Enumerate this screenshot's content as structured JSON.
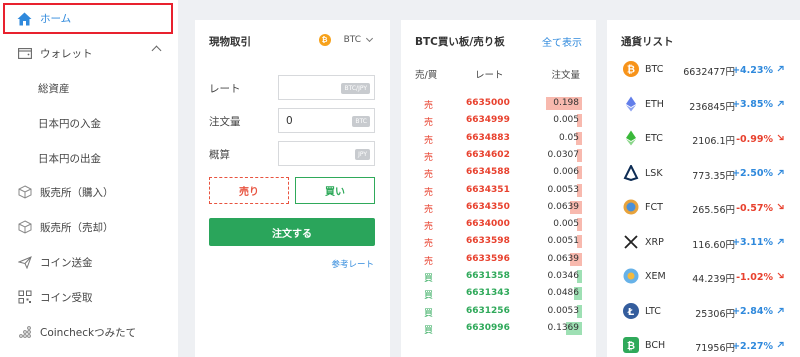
{
  "sidebar": {
    "items": [
      {
        "label": "ホーム",
        "icon": "home-icon",
        "active": true
      },
      {
        "label": "ウォレット",
        "icon": "wallet-icon"
      },
      {
        "label": "総資産"
      },
      {
        "label": "日本円の入金"
      },
      {
        "label": "日本円の出金"
      },
      {
        "label": "販売所（購入）",
        "icon": "cube-icon"
      },
      {
        "label": "販売所（売却）",
        "icon": "cube-icon"
      },
      {
        "label": "コイン送金",
        "icon": "send-icon"
      },
      {
        "label": "コイン受取",
        "icon": "qr-icon"
      },
      {
        "label": "Coincheckつみたて",
        "icon": "dots-icon"
      }
    ]
  },
  "trade": {
    "title": "現物取引",
    "coin": "BTC",
    "rate_label": "レート",
    "rate_value": "",
    "rate_unit": "BTC/JPY",
    "amount_label": "注文量",
    "amount_value": "0",
    "amount_unit": "BTC",
    "estimate_label": "概算",
    "estimate_value": "",
    "estimate_unit": "JPY",
    "sell_label": "売り",
    "buy_label": "買い",
    "order_label": "注文する",
    "ref_link": "参考レート"
  },
  "book": {
    "title": "BTC買い板/売り板",
    "link": "全て表示",
    "headers": {
      "side": "売/買",
      "rate": "レート",
      "amount": "注文量"
    },
    "rows": [
      {
        "side": "売",
        "type": "sell",
        "price": "6635000",
        "amount": "0.198",
        "depth": 0.45
      },
      {
        "side": "売",
        "type": "sell",
        "price": "6634999",
        "amount": "0.005",
        "depth": 0.0
      },
      {
        "side": "売",
        "type": "sell",
        "price": "6634883",
        "amount": "0.05",
        "depth": 0.08
      },
      {
        "side": "売",
        "type": "sell",
        "price": "6634602",
        "amount": "0.0307",
        "depth": 0.05
      },
      {
        "side": "売",
        "type": "sell",
        "price": "6634588",
        "amount": "0.006",
        "depth": 0.0
      },
      {
        "side": "売",
        "type": "sell",
        "price": "6634351",
        "amount": "0.0053",
        "depth": 0.05
      },
      {
        "side": "売",
        "type": "sell",
        "price": "6634350",
        "amount": "0.0639",
        "depth": 0.15
      },
      {
        "side": "売",
        "type": "sell",
        "price": "6634000",
        "amount": "0.005",
        "depth": 0.0
      },
      {
        "side": "売",
        "type": "sell",
        "price": "6633598",
        "amount": "0.0051",
        "depth": 0.05
      },
      {
        "side": "売",
        "type": "sell",
        "price": "6633596",
        "amount": "0.0639",
        "depth": 0.15
      },
      {
        "side": "買",
        "type": "buy",
        "price": "6631358",
        "amount": "0.0346",
        "depth": 0.05
      },
      {
        "side": "買",
        "type": "buy",
        "price": "6631343",
        "amount": "0.0486",
        "depth": 0.1
      },
      {
        "side": "買",
        "type": "buy",
        "price": "6631256",
        "amount": "0.0053",
        "depth": 0.05
      },
      {
        "side": "買",
        "type": "buy",
        "price": "6630996",
        "amount": "0.1369",
        "depth": 0.2
      }
    ]
  },
  "currencies": {
    "title": "通貨リスト",
    "items": [
      {
        "symbol": "BTC",
        "price": "6632477円",
        "change": "+4.23%",
        "dir": "up",
        "icon": "btc-icon",
        "color": "#f7931a"
      },
      {
        "symbol": "ETH",
        "price": "236845円",
        "change": "+3.85%",
        "dir": "up",
        "icon": "eth-icon",
        "color": "#627eea"
      },
      {
        "symbol": "ETC",
        "price": "2106.1円",
        "change": "-0.99%",
        "dir": "down",
        "icon": "etc-icon",
        "color": "#3ab83a"
      },
      {
        "symbol": "LSK",
        "price": "773.35円",
        "change": "+2.50%",
        "dir": "up",
        "icon": "lsk-icon",
        "color": "#0d2c54"
      },
      {
        "symbol": "FCT",
        "price": "265.56円",
        "change": "-0.57%",
        "dir": "down",
        "icon": "fct-icon",
        "color": "#e8a33c"
      },
      {
        "symbol": "XRP",
        "price": "116.60円",
        "change": "+3.11%",
        "dir": "up",
        "icon": "xrp-icon",
        "color": "#222222"
      },
      {
        "symbol": "XEM",
        "price": "44.239円",
        "change": "-1.02%",
        "dir": "down",
        "icon": "xem-icon",
        "color": "#67b2e8"
      },
      {
        "symbol": "LTC",
        "price": "25306円",
        "change": "+2.84%",
        "dir": "up",
        "icon": "ltc-icon",
        "color": "#345d9d"
      },
      {
        "symbol": "BCH",
        "price": "71956円",
        "change": "+2.27%",
        "dir": "up",
        "icon": "bch-icon",
        "color": "#2fa95a"
      }
    ]
  }
}
